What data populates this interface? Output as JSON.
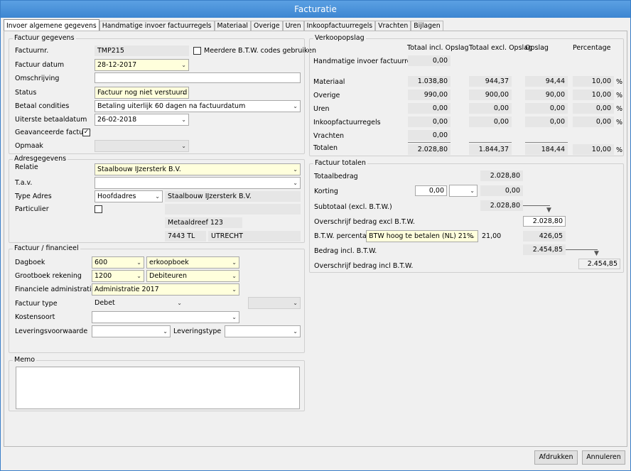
{
  "window": {
    "title": "Facturatie"
  },
  "tabs": [
    "Invoer algemene gegevens",
    "Handmatige invoer factuurregels",
    "Materiaal",
    "Overige",
    "Uren",
    "Inkoopfactuurregels",
    "Vrachten",
    "Bijlagen"
  ],
  "factuur": {
    "title": "Factuur gegevens",
    "nr_label": "Factuurnr.",
    "nr": "TMP215",
    "btw_label": "Meerdere B.T.W. codes gebruiken",
    "datum_label": "Factuur datum",
    "datum": "28-12-2017",
    "omschr_label": "Omschrijving",
    "omschr": "",
    "status_label": "Status",
    "status": "Factuur nog niet verstuurd",
    "betaal_label": "Betaal condities",
    "betaal": "Betaling uiterlijk 60 dagen na factuurdatum",
    "uiterste_label": "Uiterste betaaldatum",
    "uiterste": "26-02-2018",
    "geav_label": "Geavanceerde factuur",
    "opmaak_label": "Opmaak"
  },
  "adres": {
    "title": "Adresgegevens",
    "relatie_label": "Relatie",
    "relatie": "Staalbouw IJzersterk B.V.",
    "tav_label": "T.a.v.",
    "type_label": "Type Adres",
    "type": "Hoofdadres",
    "naam": "Staalbouw IJzersterk B.V.",
    "part_label": "Particulier",
    "straat": "Metaaldreef 123",
    "postcode": "7443 TL",
    "plaats": "UTRECHT"
  },
  "fin": {
    "title": "Factuur / financieel",
    "dagboek_label": "Dagboek",
    "dagboek": "600",
    "dagboek_naam": "erkoopboek",
    "gb_label": "Grootboek rekening",
    "gb": "1200",
    "gb_naam": "Debiteuren",
    "admin_label": "Financiele administraties",
    "admin": "Administratie 2017",
    "type_label": "Factuur type",
    "type": "Debet",
    "kosten_label": "Kostensoort",
    "lev_label": "Leveringsvoorwaarde",
    "levtype_label": "Leveringstype"
  },
  "memo": {
    "title": "Memo"
  },
  "verkoop": {
    "title": "Verkoopopslag",
    "headers": [
      "Totaal incl. Opslag",
      "Totaal excl. Opslag",
      "Opslag",
      "Percentage"
    ],
    "pct": "%",
    "rows": [
      {
        "label": "Handmatige invoer factuurregels",
        "incl": "0,00"
      },
      {
        "label": "Materiaal",
        "incl": "1.038,80",
        "excl": "944,37",
        "opslag": "94,44",
        "pct": "10,00"
      },
      {
        "label": "Overige",
        "incl": "990,00",
        "excl": "900,00",
        "opslag": "90,00",
        "pct": "10,00"
      },
      {
        "label": "Uren",
        "incl": "0,00",
        "excl": "0,00",
        "opslag": "0,00",
        "pct": "0,00"
      },
      {
        "label": "Inkoopfactuurregels",
        "incl": "0,00",
        "excl": "0,00",
        "opslag": "0,00",
        "pct": "0,00"
      },
      {
        "label": "Vrachten",
        "incl": "0,00"
      }
    ],
    "totalen": {
      "label": "Totalen",
      "incl": "2.028,80",
      "excl": "1.844,37",
      "opslag": "184,44",
      "pct": "10,00"
    }
  },
  "totalen": {
    "title": "Factuur totalen",
    "totaal_label": "Totaalbedrag",
    "totaal": "2.028,80",
    "korting_label": "Korting",
    "korting_in": "0,00",
    "korting": "0,00",
    "sub_label": "Subtotaal (excl. B.T.W.)",
    "sub": "2.028,80",
    "over_excl_label": "Overschrijf bedrag excl B.T.W.",
    "over_excl": "2.028,80",
    "btw_label": "B.T.W. percentage",
    "btw": "BTW hoog te betalen (NL) 21%",
    "btw_pct": "21,00",
    "btw_bedrag": "426,05",
    "incl_label": "Bedrag incl. B.T.W.",
    "incl": "2.454,85",
    "over_incl_label": "Overschrijf bedrag incl B.T.W.",
    "over_incl": "2.454,85"
  },
  "buttons": {
    "print": "Afdrukken",
    "cancel": "Annuleren"
  }
}
